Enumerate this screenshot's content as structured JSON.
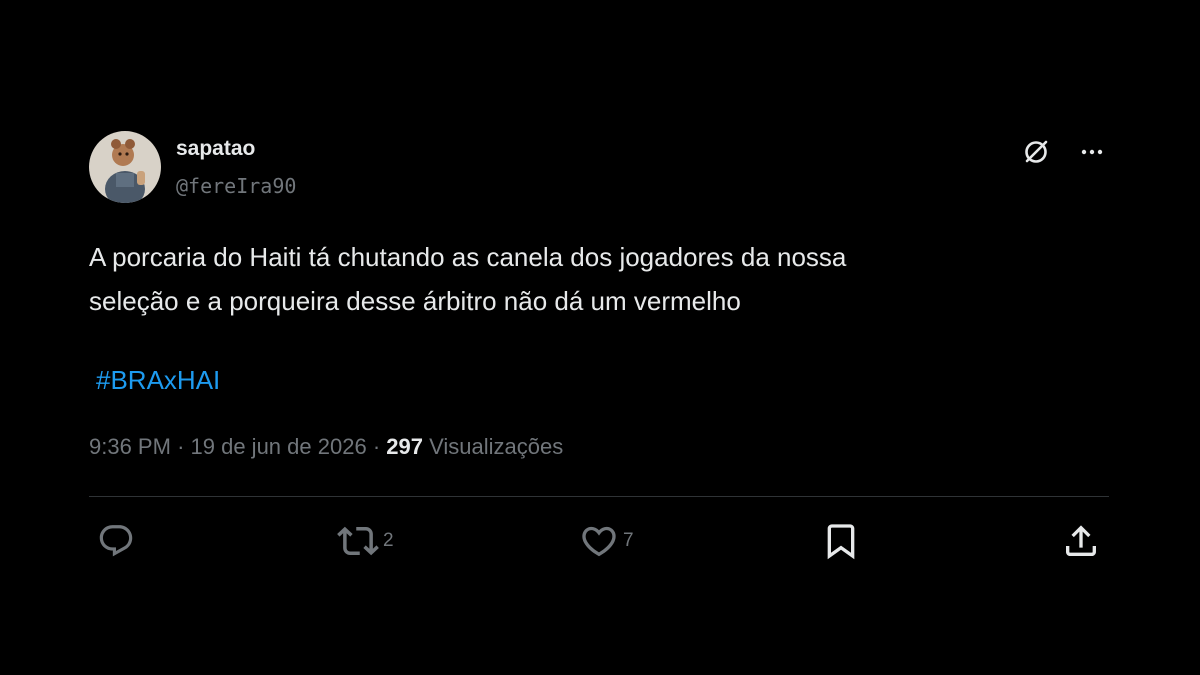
{
  "tweet": {
    "author_name": "sapatao",
    "author_handle": "@fereIra90",
    "text_line1": "A porcaria do Haiti tá chutando as canela dos jogadores da nossa",
    "text_line2": "seleção e a porqueira desse árbitro não dá um vermelho",
    "hashtag": "#BRAxHAI",
    "time": "9:36 PM",
    "separator": "·",
    "date": "19 de jun de 2026",
    "views_count": "297",
    "views_label": "Visualizações"
  },
  "actions": {
    "reply_count": "",
    "retweet_count": "2",
    "like_count": "7"
  },
  "icons": {
    "avatar": "avatar-photo",
    "grok": "grok-icon",
    "more": "more-icon",
    "reply": "reply-icon",
    "retweet": "retweet-icon",
    "like": "heart-icon",
    "bookmark": "bookmark-icon",
    "share": "share-icon"
  },
  "colors": {
    "background": "#000000",
    "text": "#e7e9ea",
    "secondary": "#71767b",
    "link": "#1d9bf0",
    "divider": "#2f3336"
  }
}
